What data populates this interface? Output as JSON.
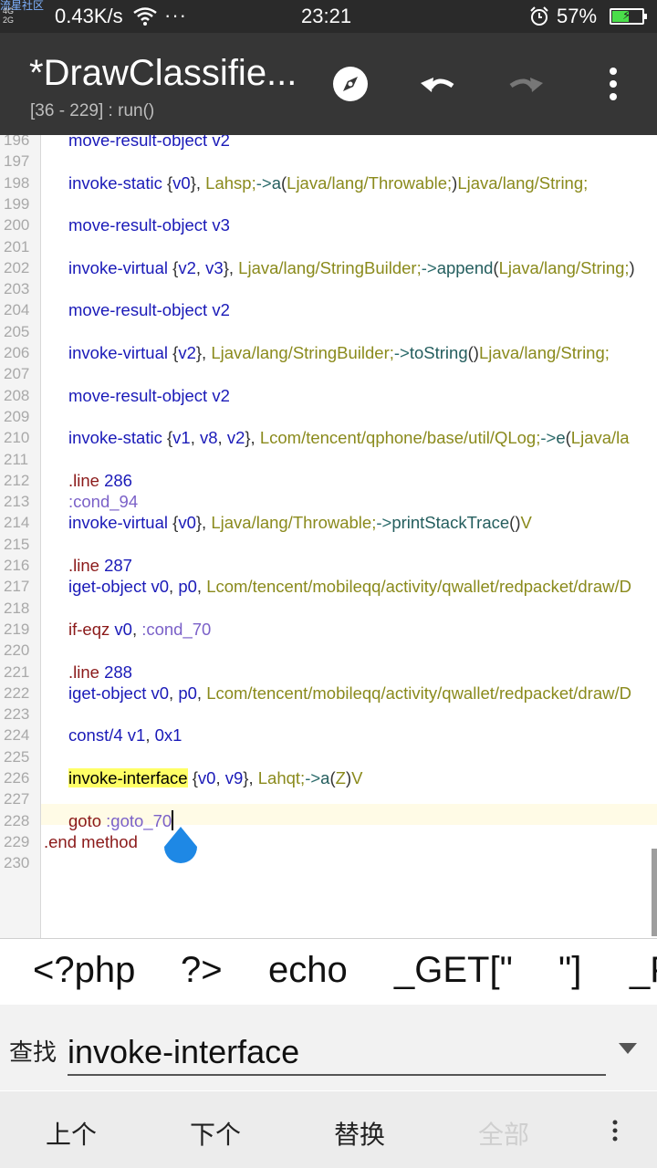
{
  "status_bar": {
    "watermark": "流星社区",
    "signal_top": "4G",
    "signal_bottom": "2G",
    "net_speed": "0.43K/s",
    "more_dots": "···",
    "time": "23:21",
    "battery_percent": "57%",
    "battery_level": 0.57
  },
  "toolbar": {
    "title": "*DrawClassifie...",
    "subtitle": "[36 - 229] : run()",
    "icons": [
      "compass-icon",
      "undo-icon",
      "redo-icon",
      "more-vert-icon"
    ]
  },
  "editor": {
    "lines": [
      {
        "n": "196",
        "tokens": [
          [
            "kw",
            "move-result-object "
          ],
          [
            "kw",
            "v2"
          ]
        ]
      },
      {
        "n": "197",
        "tokens": []
      },
      {
        "n": "198",
        "tokens": [
          [
            "kw",
            "invoke-static "
          ],
          [
            "punc",
            "{"
          ],
          [
            "kw",
            "v0"
          ],
          [
            "punc",
            "}, "
          ],
          [
            "cls",
            "Lahsp;"
          ],
          [
            "arrow",
            "->"
          ],
          [
            "method",
            "a"
          ],
          [
            "punc",
            "("
          ],
          [
            "cls",
            "Ljava/lang/Throwable;"
          ],
          [
            "punc",
            ")"
          ],
          [
            "cls",
            "Ljava/lang/String;"
          ]
        ]
      },
      {
        "n": "199",
        "tokens": []
      },
      {
        "n": "200",
        "tokens": [
          [
            "kw",
            "move-result-object "
          ],
          [
            "kw",
            "v3"
          ]
        ]
      },
      {
        "n": "201",
        "tokens": []
      },
      {
        "n": "202",
        "tokens": [
          [
            "kw",
            "invoke-virtual "
          ],
          [
            "punc",
            "{"
          ],
          [
            "kw",
            "v2"
          ],
          [
            "punc",
            ", "
          ],
          [
            "kw",
            "v3"
          ],
          [
            "punc",
            "}, "
          ],
          [
            "cls",
            "Ljava/lang/StringBuilder;"
          ],
          [
            "arrow",
            "->"
          ],
          [
            "method",
            "append"
          ],
          [
            "punc",
            "("
          ],
          [
            "cls",
            "Ljava/lang/String;"
          ],
          [
            "punc",
            ")"
          ]
        ]
      },
      {
        "n": "203",
        "tokens": []
      },
      {
        "n": "204",
        "tokens": [
          [
            "kw",
            "move-result-object "
          ],
          [
            "kw",
            "v2"
          ]
        ]
      },
      {
        "n": "205",
        "tokens": []
      },
      {
        "n": "206",
        "tokens": [
          [
            "kw",
            "invoke-virtual "
          ],
          [
            "punc",
            "{"
          ],
          [
            "kw",
            "v2"
          ],
          [
            "punc",
            "}, "
          ],
          [
            "cls",
            "Ljava/lang/StringBuilder;"
          ],
          [
            "arrow",
            "->"
          ],
          [
            "method",
            "toString"
          ],
          [
            "punc",
            "()"
          ],
          [
            "cls",
            "Ljava/lang/String;"
          ]
        ]
      },
      {
        "n": "207",
        "tokens": []
      },
      {
        "n": "208",
        "tokens": [
          [
            "kw",
            "move-result-object "
          ],
          [
            "kw",
            "v2"
          ]
        ]
      },
      {
        "n": "209",
        "tokens": []
      },
      {
        "n": "210",
        "tokens": [
          [
            "kw",
            "invoke-static "
          ],
          [
            "punc",
            "{"
          ],
          [
            "kw",
            "v1"
          ],
          [
            "punc",
            ", "
          ],
          [
            "kw",
            "v8"
          ],
          [
            "punc",
            ", "
          ],
          [
            "kw",
            "v2"
          ],
          [
            "punc",
            "}, "
          ],
          [
            "cls",
            "Lcom/tencent/qphone/base/util/QLog;"
          ],
          [
            "arrow",
            "->"
          ],
          [
            "method",
            "e"
          ],
          [
            "punc",
            "("
          ],
          [
            "cls",
            "Ljava/la"
          ]
        ]
      },
      {
        "n": "211",
        "tokens": []
      },
      {
        "n": "212",
        "tokens": [
          [
            "dir",
            ".line "
          ],
          [
            "num",
            "286"
          ]
        ]
      },
      {
        "n": "213",
        "tokens": [
          [
            "label",
            ":cond_94"
          ]
        ]
      },
      {
        "n": "214",
        "tokens": [
          [
            "kw",
            "invoke-virtual "
          ],
          [
            "punc",
            "{"
          ],
          [
            "kw",
            "v0"
          ],
          [
            "punc",
            "}, "
          ],
          [
            "cls",
            "Ljava/lang/Throwable;"
          ],
          [
            "arrow",
            "->"
          ],
          [
            "method",
            "printStackTrace"
          ],
          [
            "punc",
            "()"
          ],
          [
            "cls",
            "V"
          ]
        ]
      },
      {
        "n": "215",
        "tokens": []
      },
      {
        "n": "216",
        "tokens": [
          [
            "dir",
            ".line "
          ],
          [
            "num",
            "287"
          ]
        ]
      },
      {
        "n": "217",
        "tokens": [
          [
            "kw",
            "iget-object "
          ],
          [
            "kw",
            "v0"
          ],
          [
            "punc",
            ", "
          ],
          [
            "kw",
            "p0"
          ],
          [
            "punc",
            ", "
          ],
          [
            "cls",
            "Lcom/tencent/mobileqq/activity/qwallet/redpacket/draw/D"
          ]
        ]
      },
      {
        "n": "218",
        "tokens": []
      },
      {
        "n": "219",
        "tokens": [
          [
            "dir",
            "if-eqz "
          ],
          [
            "kw",
            "v0"
          ],
          [
            "punc",
            ", "
          ],
          [
            "label",
            ":cond_70"
          ]
        ]
      },
      {
        "n": "220",
        "tokens": []
      },
      {
        "n": "221",
        "tokens": [
          [
            "dir",
            ".line "
          ],
          [
            "num",
            "288"
          ]
        ]
      },
      {
        "n": "222",
        "tokens": [
          [
            "kw",
            "iget-object "
          ],
          [
            "kw",
            "v0"
          ],
          [
            "punc",
            ", "
          ],
          [
            "kw",
            "p0"
          ],
          [
            "punc",
            ", "
          ],
          [
            "cls",
            "Lcom/tencent/mobileqq/activity/qwallet/redpacket/draw/D"
          ]
        ]
      },
      {
        "n": "223",
        "tokens": []
      },
      {
        "n": "224",
        "tokens": [
          [
            "kw",
            "const/4 "
          ],
          [
            "kw",
            "v1"
          ],
          [
            "punc",
            ", "
          ],
          [
            "num",
            "0x1"
          ]
        ]
      },
      {
        "n": "225",
        "tokens": []
      },
      {
        "n": "226",
        "tokens": [
          [
            "hl",
            "invoke-interface"
          ],
          [
            "punc",
            " {"
          ],
          [
            "kw",
            "v0"
          ],
          [
            "punc",
            ", "
          ],
          [
            "kw",
            "v9"
          ],
          [
            "punc",
            "}, "
          ],
          [
            "cls",
            "Lahqt;"
          ],
          [
            "arrow",
            "->"
          ],
          [
            "method",
            "a"
          ],
          [
            "punc",
            "("
          ],
          [
            "cls",
            "Z"
          ],
          [
            "punc",
            ")"
          ],
          [
            "cls",
            "V"
          ]
        ]
      },
      {
        "n": "227",
        "tokens": []
      },
      {
        "n": "228",
        "tokens": [
          [
            "dir",
            "goto "
          ],
          [
            "label",
            ":goto_70"
          ]
        ],
        "caret": true
      },
      {
        "n": "229",
        "tokens": [
          [
            "dir",
            ".end "
          ],
          [
            "dir",
            "method"
          ]
        ],
        "indent": "outer"
      },
      {
        "n": "230",
        "tokens": []
      }
    ]
  },
  "symbols": [
    "<?php",
    "?>",
    "echo",
    "_GET[\"",
    "\"]",
    "_P"
  ],
  "find": {
    "label": "查找",
    "value": "invoke-interface"
  },
  "actions": {
    "prev": "上个",
    "next": "下个",
    "replace": "替换",
    "all": "全部"
  },
  "colors": {
    "toolbar": "#363636",
    "status_bar": "#2a2a2a",
    "highlight": "#ffff66",
    "cursor_handle": "#1e88e5"
  }
}
